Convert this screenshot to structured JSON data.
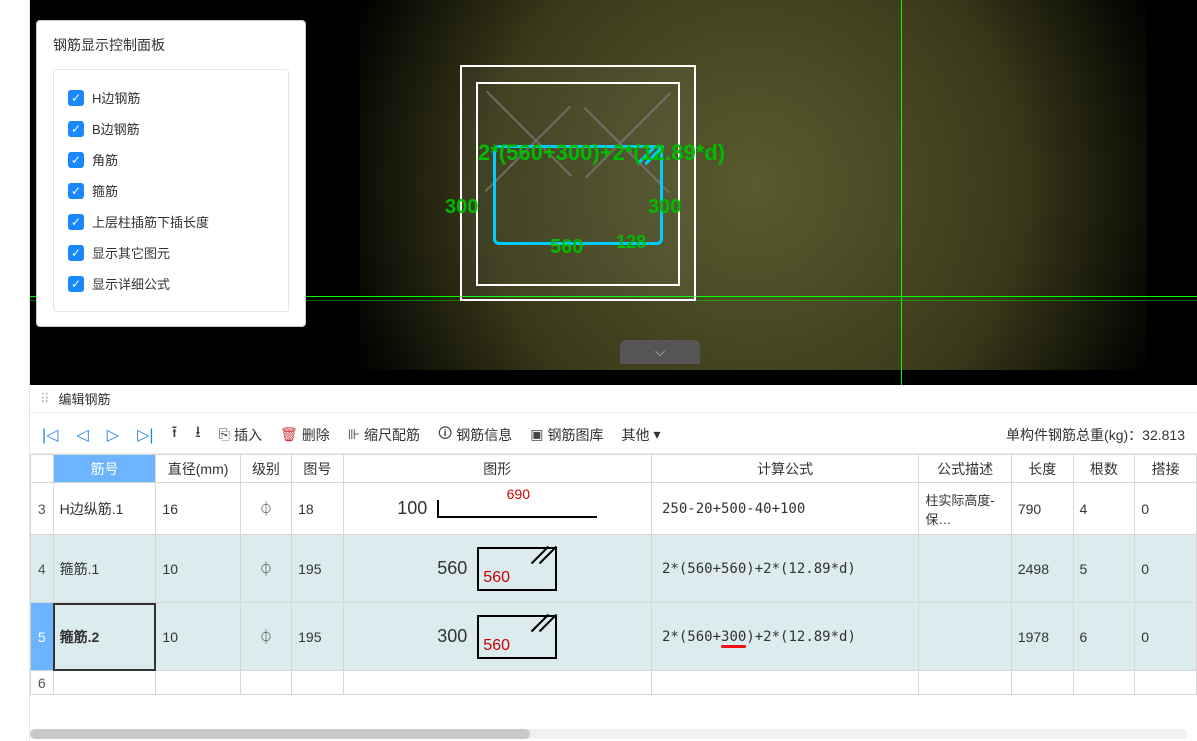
{
  "panel": {
    "title": "钢筋显示控制面板",
    "items": [
      {
        "label": "H边钢筋"
      },
      {
        "label": "B边钢筋"
      },
      {
        "label": "角筋"
      },
      {
        "label": "箍筋"
      },
      {
        "label": "上层柱插筋下插长度"
      },
      {
        "label": "显示其它图元"
      },
      {
        "label": "显示详细公式"
      }
    ]
  },
  "viewport": {
    "formula": "2*(560+300)+2*(12.89*d)",
    "dim_300_left": "300",
    "dim_300_right": "300",
    "dim_560": "560",
    "dim_128": "128"
  },
  "section_title": "编辑钢筋",
  "toolbar": {
    "insert": "插入",
    "delete": "删除",
    "scale": "缩尺配筋",
    "info": "钢筋信息",
    "library": "钢筋图库",
    "other": "其他",
    "total_label": "单构件钢筋总重(kg)：",
    "total_value": "32.813"
  },
  "columns": {
    "c0": "筋号",
    "c1": "直径(mm)",
    "c2": "级别",
    "c3": "图号",
    "c4": "图形",
    "c5": "计算公式",
    "c6": "公式描述",
    "c7": "长度",
    "c8": "根数",
    "c9": "搭接"
  },
  "rows": [
    {
      "idx": "3",
      "name": "H边纵筋.1",
      "dia": "16",
      "grade": "⏀",
      "fig": "18",
      "shape_outer": "100",
      "shape_inner": "690",
      "formula": "250-20+500-40+100",
      "desc": "柱实际高度-保…",
      "len": "790",
      "qty": "4",
      "lap": "0"
    },
    {
      "idx": "4",
      "name": "箍筋.1",
      "dia": "10",
      "grade": "⏀",
      "fig": "195",
      "shape_outer": "560",
      "shape_inner": "560",
      "formula": "2*(560+560)+2*(12.89*d)",
      "desc": "",
      "len": "2498",
      "qty": "5",
      "lap": "0"
    },
    {
      "idx": "5",
      "name": "箍筋.2",
      "dia": "10",
      "grade": "⏀",
      "fig": "195",
      "shape_outer": "300",
      "shape_inner": "560",
      "formula_pre": "2*(560+",
      "formula_mid": "300",
      "formula_post": ")+2*(12.89*d)",
      "desc": "",
      "len": "1978",
      "qty": "6",
      "lap": "0"
    }
  ],
  "empty_row_idx": "6"
}
